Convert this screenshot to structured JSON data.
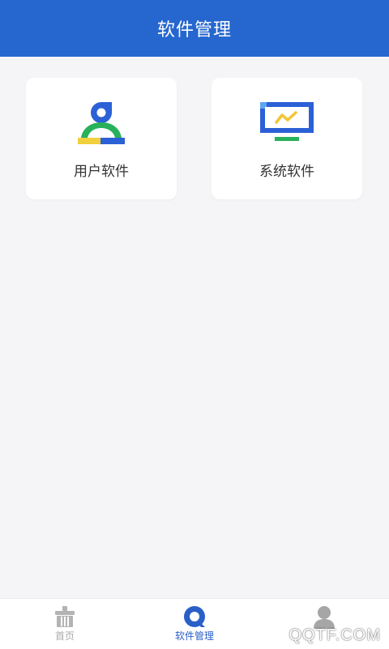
{
  "header": {
    "title": "软件管理"
  },
  "cards": [
    {
      "label": "用户软件",
      "icon": "user-software-icon"
    },
    {
      "label": "系统软件",
      "icon": "system-software-icon"
    }
  ],
  "tabbar": {
    "tabs": [
      {
        "label": "首页",
        "icon": "home-icon",
        "active": false
      },
      {
        "label": "软件管理",
        "icon": "search-icon",
        "active": true
      },
      {
        "label": "",
        "icon": "profile-icon",
        "active": false
      }
    ]
  },
  "watermark": "QQTF.COM",
  "colors": {
    "header": "#2667cf",
    "accent": "#2b5fc8",
    "background": "#f5f5f7"
  }
}
